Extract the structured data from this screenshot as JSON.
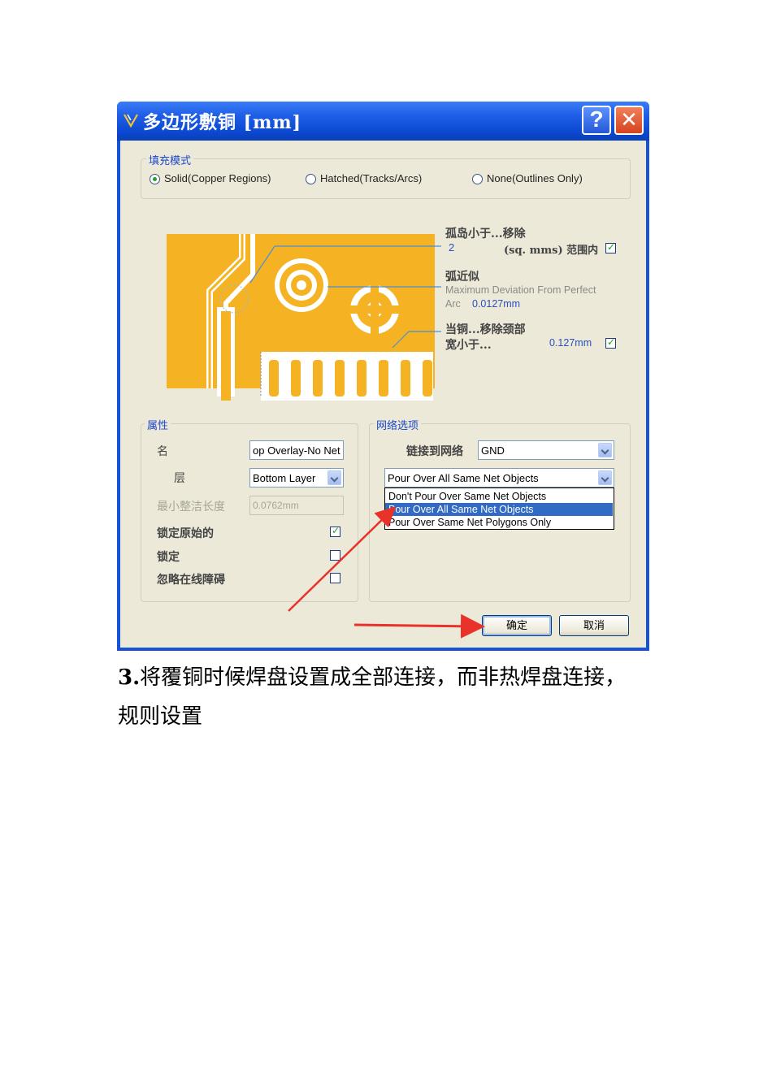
{
  "window": {
    "title": "多边形敷铜 [mm]",
    "help_glyph": "?",
    "close_glyph": "✕"
  },
  "fill_mode": {
    "legend": "填充模式",
    "options": [
      {
        "label": "Solid(Copper Regions)",
        "selected": true
      },
      {
        "label": "Hatched(Tracks/Arcs)",
        "selected": false
      },
      {
        "label": "None(Outlines Only)",
        "selected": false
      }
    ]
  },
  "preview": {
    "island": {
      "label": "孤岛小于...移除",
      "value": "2",
      "unit": "(sq. mms) 范围内",
      "checked": true
    },
    "arc": {
      "label": "弧近似",
      "desc1": "Maximum Deviation From Perfect",
      "desc2": "Arc",
      "value": "0.0127mm"
    },
    "neck": {
      "label": "当铜...移除颈部",
      "label2": "宽小于...",
      "value": "0.127mm",
      "checked": true
    }
  },
  "properties": {
    "legend": "属性",
    "name_label": "名",
    "name_value": "op Overlay-No Net",
    "layer_label": "层",
    "layer_value": "Bottom Layer",
    "min_len_label": "最小整洁长度",
    "min_len_value": "0.0762mm",
    "lock_primitives_label": "锁定原始的",
    "lock_primitives_checked": true,
    "locked_label": "锁定",
    "locked_checked": false,
    "ignore_label": "忽略在线障碍",
    "ignore_checked": false
  },
  "net_options": {
    "legend": "网络选项",
    "connect_label": "链接到网络",
    "connect_value": "GND",
    "pour_value": "Pour Over All Same Net Objects",
    "pour_options": [
      {
        "label": "Don't Pour Over Same Net Objects",
        "selected": false
      },
      {
        "label": "Pour Over All Same Net Objects",
        "selected": true
      },
      {
        "label": "Pour Over Same Net Polygons Only",
        "selected": false
      }
    ]
  },
  "buttons": {
    "ok": "确定",
    "cancel": "取消"
  },
  "caption": {
    "number": "3.",
    "line1": "将覆铜时候焊盘设置成全部连接，而非热焊盘连接，",
    "line2": "规则设置"
  },
  "colors": {
    "title_bar": "#1f5fe8",
    "copper": "#f5b323",
    "selection": "#316ac5",
    "arrow": "#e8322a"
  }
}
